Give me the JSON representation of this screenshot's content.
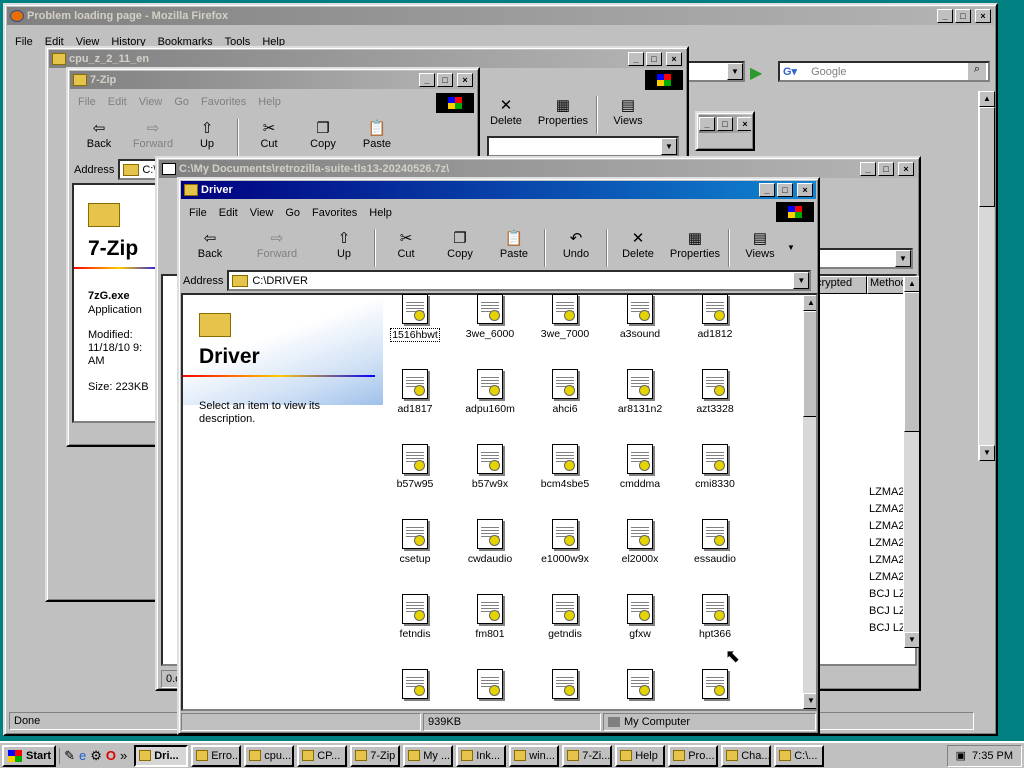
{
  "firefox": {
    "title": "Problem loading page - Mozilla Firefox",
    "menu": [
      "File",
      "Edit",
      "View",
      "History",
      "Bookmarks",
      "Tools",
      "Help"
    ],
    "search_placeholder": "Google",
    "status": "Done"
  },
  "cpuz": {
    "title": "cpu_z_2_11_en",
    "toolbar": [
      "Delete",
      "Properties",
      "Views"
    ]
  },
  "sevenzip": {
    "title": "7-Zip",
    "menu": [
      "File",
      "Edit",
      "View",
      "Go",
      "Favorites",
      "Help"
    ],
    "toolbar": [
      "Back",
      "Forward",
      "Up",
      "Cut",
      "Copy",
      "Paste"
    ],
    "address_label": "Address",
    "address_value": "C:\\",
    "panel_title": "7-Zip",
    "file_name": "7zG.exe",
    "file_type": "Application",
    "modified_label": "Modified:",
    "modified_value": "11/18/10 9:",
    "modified_ampm": "AM",
    "size_label": "Size: 223KB"
  },
  "archive": {
    "title": "C:\\My Documents\\retrozilla-suite-tls13-20240526.7z\\",
    "col_encrypted": "crypted",
    "col_method": "Method",
    "methods": [
      "LZMA2",
      "LZMA2",
      "LZMA2",
      "LZMA2",
      "LZMA2",
      "LZMA2",
      "BCJ LZ",
      "BCJ LZ",
      "BCJ LZ"
    ],
    "status": "0.o"
  },
  "driver": {
    "title": "Driver",
    "menu": [
      "File",
      "Edit",
      "View",
      "Go",
      "Favorites",
      "Help"
    ],
    "toolbar": [
      "Back",
      "Forward",
      "Up",
      "Cut",
      "Copy",
      "Paste",
      "Undo",
      "Delete",
      "Properties",
      "Views"
    ],
    "address_label": "Address",
    "address_value": "C:\\DRIVER",
    "panel_title": "Driver",
    "panel_hint": "Select an item to view its description.",
    "status_size": "939KB",
    "status_location": "My Computer",
    "files": [
      "1516hbwt",
      "3we_6000",
      "3we_7000",
      "a3sound",
      "ad1812",
      "ad1817",
      "adpu160m",
      "ahci6",
      "ar8131n2",
      "azt3328",
      "b57w95",
      "b57w9x",
      "bcm4sbe5",
      "cmddma",
      "cmi8330",
      "csetup",
      "cwdaudio",
      "e1000w9x",
      "el2000x",
      "essaudio",
      "fetndis",
      "fm801",
      "getndis",
      "gfxw",
      "hpt366",
      "",
      "",
      "",
      "",
      ""
    ]
  },
  "taskbar": {
    "start": "Start",
    "clock": "7:35 PM",
    "items": [
      "Dri...",
      "Erro...",
      "cpu...",
      "CP...",
      "7-Zip",
      "My ...",
      "Ink...",
      "win...",
      "7-Zi...",
      "Help",
      "Pro...",
      "Cha...",
      "C:\\..."
    ]
  },
  "icons": [
    "firefox-icon",
    "folder-icon",
    "file-icon",
    "windows-flag-icon"
  ]
}
